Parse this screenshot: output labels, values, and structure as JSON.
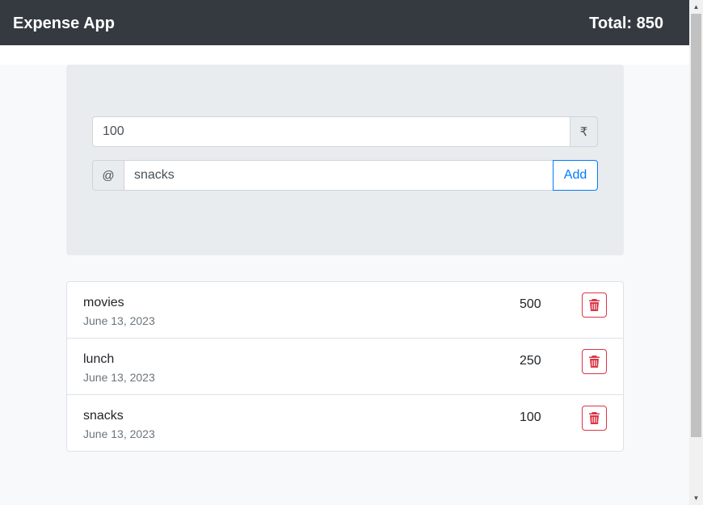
{
  "header": {
    "title": "Expense App",
    "total": "Total: 850"
  },
  "form": {
    "amount_value": "100",
    "currency_symbol": "₹",
    "prefix_symbol": "@",
    "name_value": "snacks",
    "add_label": "Add"
  },
  "expenses": [
    {
      "name": "movies",
      "date": "June 13, 2023",
      "amount": "500"
    },
    {
      "name": "lunch",
      "date": "June 13, 2023",
      "amount": "250"
    },
    {
      "name": "snacks",
      "date": "June 13, 2023",
      "amount": "100"
    }
  ],
  "icons": {
    "delete": "trash-icon"
  },
  "colors": {
    "navbar": "#343a40",
    "primary": "#007bff",
    "danger": "#dc3545"
  }
}
